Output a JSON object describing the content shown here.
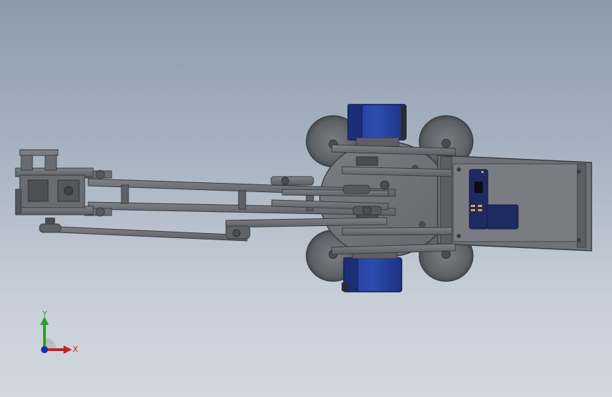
{
  "triad": {
    "x_label": "X",
    "y_label": "Y"
  },
  "colors": {
    "background_top": "#8c9aac",
    "background_bottom": "#d3d8df",
    "part_gray": "#6e7077",
    "part_dark": "#4a4c52",
    "motor_blue": "#1f3a8f",
    "axis_x": "#cc2020",
    "axis_y": "#2ca02c",
    "axis_z": "#1a2fb0"
  },
  "parts": {
    "motor_count": 2,
    "wheel_count": 4
  }
}
